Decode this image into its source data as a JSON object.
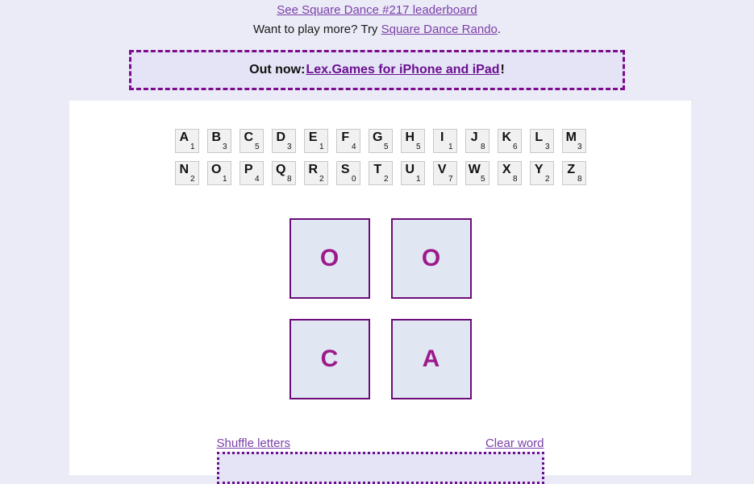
{
  "header": {
    "leaderboard_link": "See Square Dance #217 leaderboard",
    "play_more_prefix": "Want to play more? Try ",
    "rando_link": "Square Dance Rando",
    "play_more_suffix": "."
  },
  "promo": {
    "prefix": "Out now: ",
    "link": "Lex.Games for iPhone and iPad",
    "suffix": "!"
  },
  "rack": {
    "row1": [
      {
        "letter": "A",
        "value": "1"
      },
      {
        "letter": "B",
        "value": "3"
      },
      {
        "letter": "C",
        "value": "5"
      },
      {
        "letter": "D",
        "value": "3"
      },
      {
        "letter": "E",
        "value": "1"
      },
      {
        "letter": "F",
        "value": "4"
      },
      {
        "letter": "G",
        "value": "5"
      },
      {
        "letter": "H",
        "value": "5"
      },
      {
        "letter": "I",
        "value": "1"
      },
      {
        "letter": "J",
        "value": "8"
      },
      {
        "letter": "K",
        "value": "6"
      },
      {
        "letter": "L",
        "value": "3"
      },
      {
        "letter": "M",
        "value": "3"
      }
    ],
    "row2": [
      {
        "letter": "N",
        "value": "2"
      },
      {
        "letter": "O",
        "value": "1"
      },
      {
        "letter": "P",
        "value": "4"
      },
      {
        "letter": "Q",
        "value": "8"
      },
      {
        "letter": "R",
        "value": "2"
      },
      {
        "letter": "S",
        "value": "0"
      },
      {
        "letter": "T",
        "value": "2"
      },
      {
        "letter": "U",
        "value": "1"
      },
      {
        "letter": "V",
        "value": "7"
      },
      {
        "letter": "W",
        "value": "5"
      },
      {
        "letter": "X",
        "value": "8"
      },
      {
        "letter": "Y",
        "value": "2"
      },
      {
        "letter": "Z",
        "value": "8"
      }
    ]
  },
  "grid": {
    "cells": [
      "O",
      "O",
      "C",
      "A"
    ]
  },
  "controls": {
    "shuffle_label": "Shuffle letters",
    "clear_label": "Clear word",
    "word_value": ""
  },
  "colors": {
    "page_background": "#ebebf7",
    "panel_background": "#ffffff",
    "link": "#7a3fa8",
    "accent_purple": "#6b0f8f",
    "grid_letter": "#9c1a8c",
    "grid_cell_fill": "#e1e7f2",
    "grid_cell_border": "#6a0d78",
    "rack_tile_fill": "#f1f1f1"
  }
}
